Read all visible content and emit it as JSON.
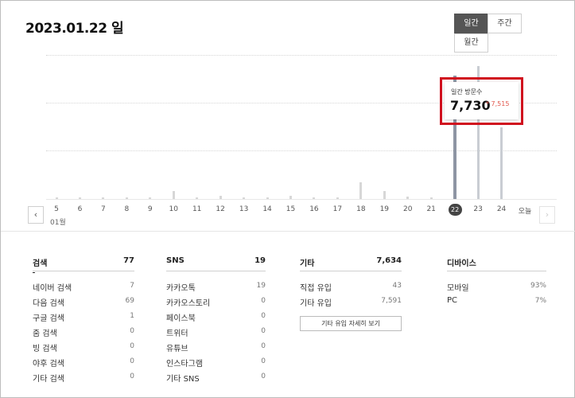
{
  "header": {
    "title": "2023.01.22 일"
  },
  "period_toggle": {
    "daily": "일간",
    "weekly": "주간",
    "monthly": "월간",
    "active": "일간"
  },
  "chart": {
    "month_label": "01월",
    "prev_icon": "chevron-left-icon",
    "next_icon": "chevron-right-icon",
    "tooltip": {
      "label": "일간 방문수",
      "value": "7,730",
      "delta": "* 7,515"
    },
    "accent_delta_color": "#e2574c",
    "highlight_color": "#d0101e"
  },
  "chart_data": {
    "type": "bar",
    "categories": [
      "5",
      "6",
      "7",
      "8",
      "9",
      "10",
      "11",
      "12",
      "13",
      "14",
      "15",
      "16",
      "17",
      "18",
      "19",
      "20",
      "21",
      "22",
      "23",
      "24",
      "오늘"
    ],
    "values": [
      20,
      30,
      20,
      40,
      60,
      480,
      40,
      180,
      40,
      30,
      180,
      20,
      20,
      1030,
      520,
      140,
      80,
      7730,
      8300,
      4490,
      0
    ],
    "selected_category": "22"
  },
  "stats": {
    "search": {
      "title": "검색",
      "total": "77",
      "rows": [
        {
          "label": "네이버 검색",
          "value": "7"
        },
        {
          "label": "다음 검색",
          "value": "69"
        },
        {
          "label": "구글 검색",
          "value": "1"
        },
        {
          "label": "줌 검색",
          "value": "0"
        },
        {
          "label": "빙 검색",
          "value": "0"
        },
        {
          "label": "야후 검색",
          "value": "0"
        },
        {
          "label": "기타 검색",
          "value": "0"
        }
      ]
    },
    "sns": {
      "title": "SNS",
      "total": "19",
      "rows": [
        {
          "label": "카카오톡",
          "value": "19"
        },
        {
          "label": "카카오스토리",
          "value": "0"
        },
        {
          "label": "페이스북",
          "value": "0"
        },
        {
          "label": "트위터",
          "value": "0"
        },
        {
          "label": "유튜브",
          "value": "0"
        },
        {
          "label": "인스타그램",
          "value": "0"
        },
        {
          "label": "기타 SNS",
          "value": "0"
        }
      ]
    },
    "etc": {
      "title": "기타",
      "total": "7,634",
      "rows": [
        {
          "label": "직접 유입",
          "value": "43"
        },
        {
          "label": "기타 유입",
          "value": "7,591"
        }
      ],
      "detail_button": "기타 유입 자세히 보기"
    },
    "device": {
      "title": "디바이스",
      "total": "",
      "rows": [
        {
          "label": "모바일",
          "value": "93%"
        },
        {
          "label": "PC",
          "value": "7%"
        }
      ]
    }
  }
}
